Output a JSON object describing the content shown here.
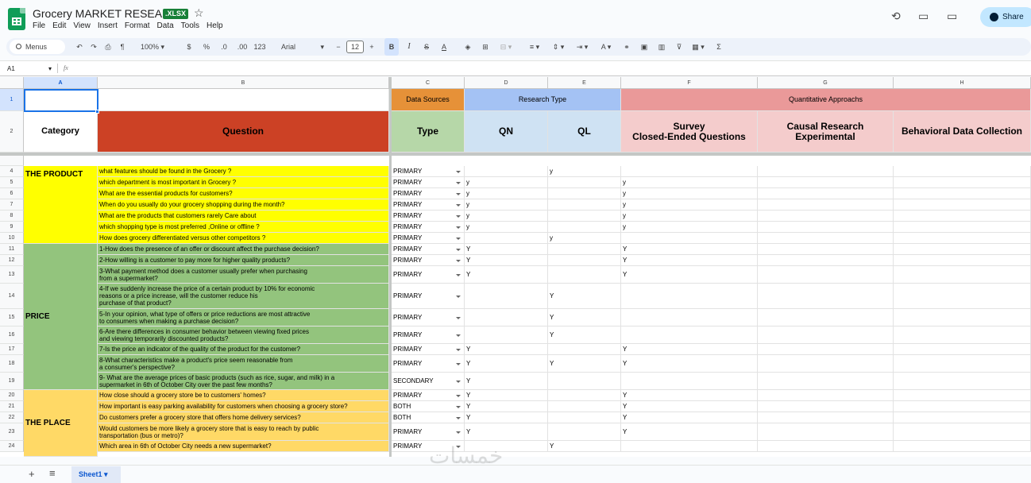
{
  "app": {
    "title": "Grocery MARKET RESEARCH",
    "badge": ".XLSX",
    "share_label": "Share",
    "menu": [
      "File",
      "Edit",
      "View",
      "Insert",
      "Format",
      "Data",
      "Tools",
      "Help"
    ]
  },
  "toolbar": {
    "search_placeholder": "Menus",
    "zoom": "100%",
    "currency": "$",
    "percent": "%",
    "dec_decrease": ".0",
    "dec_increase": ".00",
    "number_format": "123",
    "font": "Arial",
    "font_size": "12",
    "bold": "B",
    "italic": "I",
    "text_color": "A",
    "sum": "Σ"
  },
  "formula_bar": {
    "name_box": "A1",
    "fx": "fx",
    "content": ""
  },
  "columns": [
    "A",
    "B",
    "C",
    "D",
    "E",
    "F",
    "G",
    "H"
  ],
  "header_rows": {
    "row1": {
      "data_sources": "Data Sources",
      "research_type": "Research Type",
      "quant": "Quantitative Approachs"
    },
    "row2": {
      "category": "Category",
      "question": "Question",
      "type": "Type",
      "qn": "QN",
      "ql": "QL",
      "survey": "Survey\nClosed-Ended Questions",
      "causal": "Causal Research\nExperimental",
      "behavioral": "Behavioral Data Collection"
    }
  },
  "categories": [
    "THE PRODUCT",
    "PRICE",
    "THE PLACE"
  ],
  "rows": [
    {
      "num": "4",
      "q": "what features should be found in the Grocery ?",
      "src": "PRIMARY",
      "qn": "",
      "ql": "y",
      "survey": ""
    },
    {
      "num": "5",
      "q": "which department is most important in Grocery ?",
      "src": "PRIMARY",
      "qn": "y",
      "ql": "",
      "survey": "y"
    },
    {
      "num": "6",
      "q": "What are the essential products for customers?",
      "src": "PRIMARY",
      "qn": "y",
      "ql": "",
      "survey": "y"
    },
    {
      "num": "7",
      "q": "When do you usually do your grocery shopping during the month?",
      "src": "PRIMARY",
      "qn": "y",
      "ql": "",
      "survey": "y"
    },
    {
      "num": "8",
      "q": "What are the products that customers rarely Care about",
      "src": "PRIMARY",
      "qn": "y",
      "ql": "",
      "survey": "y"
    },
    {
      "num": "9",
      "q": "which shopping type is most preferred ,Online or offline ?",
      "src": "PRIMARY",
      "qn": "y",
      "ql": "",
      "survey": "y"
    },
    {
      "num": "10",
      "q": "How  does grocery differentiated versus other competitors ?",
      "src": "PRIMARY",
      "qn": "",
      "ql": "y",
      "survey": ""
    },
    {
      "num": "11",
      "q": "1-How does the presence of an offer or discount affect the purchase decision?",
      "src": "PRIMARY",
      "qn": "Y",
      "ql": "",
      "survey": "Y"
    },
    {
      "num": "12",
      "q": "2-How willing is a customer to pay more for higher quality products?",
      "src": "PRIMARY",
      "qn": "Y",
      "ql": "",
      "survey": "Y"
    },
    {
      "num": "13",
      "q": "3-What payment method does a customer usually prefer when purchasing\nfrom a supermarket?",
      "src": "PRIMARY",
      "qn": "Y",
      "ql": "",
      "survey": "Y"
    },
    {
      "num": "14",
      "q": "4-If we suddenly increase the price of a certain product by 10% for economic\nreasons or a price increase, will the customer reduce his\n purchase of that product?",
      "src": "PRIMARY",
      "qn": "",
      "ql": "Y",
      "survey": ""
    },
    {
      "num": "15",
      "q": "5-In your opinion, what type of offers or price reductions are most attractive\n to consumers when making a purchase decision?",
      "src": "PRIMARY",
      "qn": "",
      "ql": "Y",
      "survey": ""
    },
    {
      "num": "16",
      "q": "6-Are there differences in consumer behavior between viewing fixed prices\n and viewing temporarily discounted products?",
      "src": "PRIMARY",
      "qn": "",
      "ql": "Y",
      "survey": ""
    },
    {
      "num": "17",
      "q": "7-Is the price an indicator of the quality of the product for the customer?",
      "src": "PRIMARY",
      "qn": "Y",
      "ql": "",
      "survey": "Y"
    },
    {
      "num": "18",
      "q": "8-What characteristics make a product's price seem reasonable from\n a consumer's perspective?",
      "src": "PRIMARY",
      "qn": "Y",
      "ql": "Y",
      "survey": "Y"
    },
    {
      "num": "19",
      "q": "9- What are the average prices of basic products (such as rice, sugar, and milk) in a\n supermarket in 6th of October City over the past few months?",
      "src": "SECONDARY",
      "qn": "Y",
      "ql": "",
      "survey": ""
    },
    {
      "num": "20",
      "q": "How close should a grocery store be to customers' homes?",
      "src": "PRIMARY",
      "qn": "Y",
      "ql": "",
      "survey": "Y"
    },
    {
      "num": "21",
      "q": "How important is easy parking availability for customers when choosing a grocery store?",
      "src": "BOTH",
      "qn": "Y",
      "ql": "",
      "survey": "Y"
    },
    {
      "num": "22",
      "q": "Do customers prefer a grocery store that offers home delivery services?",
      "src": "BOTH",
      "qn": "Y",
      "ql": "",
      "survey": "Y"
    },
    {
      "num": "23",
      "q": "Would customers be more likely a grocery store that is easy to reach by public\ntransportation (bus or metro)?",
      "src": "PRIMARY",
      "qn": "Y",
      "ql": "",
      "survey": "Y"
    },
    {
      "num": "24",
      "q": "Which area in 6th of October City needs a new supermarket?",
      "src": "PRIMARY",
      "qn": "",
      "ql": "Y",
      "survey": ""
    }
  ],
  "sheet_tab": "Sheet1",
  "colors": {
    "product": "#ffff00",
    "price": "#93c47d",
    "place": "#ffd966",
    "question_header": "#cc4125",
    "data_sources": "#e69138",
    "research_type": "#a4c2f4",
    "quant": "#ea9999",
    "type": "#b6d7a8",
    "qn_ql": "#cfe2f3",
    "quant_sub": "#f4cccc"
  }
}
